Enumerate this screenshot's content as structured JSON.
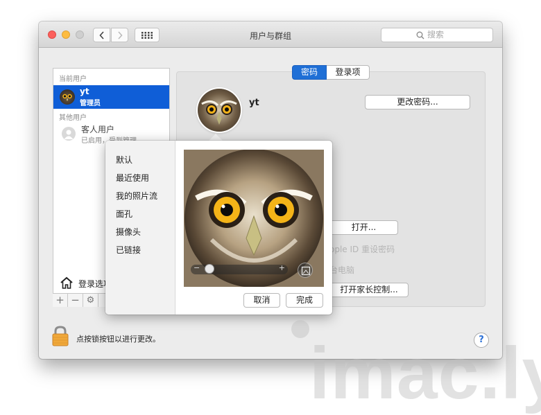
{
  "window": {
    "title": "用户与群组",
    "search_placeholder": "搜索"
  },
  "sidebar": {
    "current_users_header": "当前用户",
    "current_user": {
      "name": "yt",
      "role": "管理员"
    },
    "other_users_header": "其他用户",
    "guest_user": {
      "name": "客人用户",
      "status": "已启用，受到管理"
    },
    "login_options_label": "登录选项"
  },
  "tabs": [
    {
      "label": "密码"
    },
    {
      "label": "登录项"
    }
  ],
  "main": {
    "user_name": "yt",
    "change_password_button": "更改密码...",
    "open_button": "打开...",
    "apple_id_reset_text": "ople ID 重设密码",
    "computer_text": "台电脑",
    "parental_controls_button": "打开家长控制..."
  },
  "popover": {
    "categories": [
      "默认",
      "最近使用",
      "我的照片流",
      "面孔",
      "摄像头",
      "已链接"
    ],
    "cancel_button": "取消",
    "done_button": "完成"
  },
  "footer": {
    "lock_text": "点按锁按钮以进行更改。",
    "help_label": "?"
  },
  "watermark": "imac.ly",
  "colors": {
    "accent": "#1f6fd6",
    "selection": "#0f5ed7"
  }
}
